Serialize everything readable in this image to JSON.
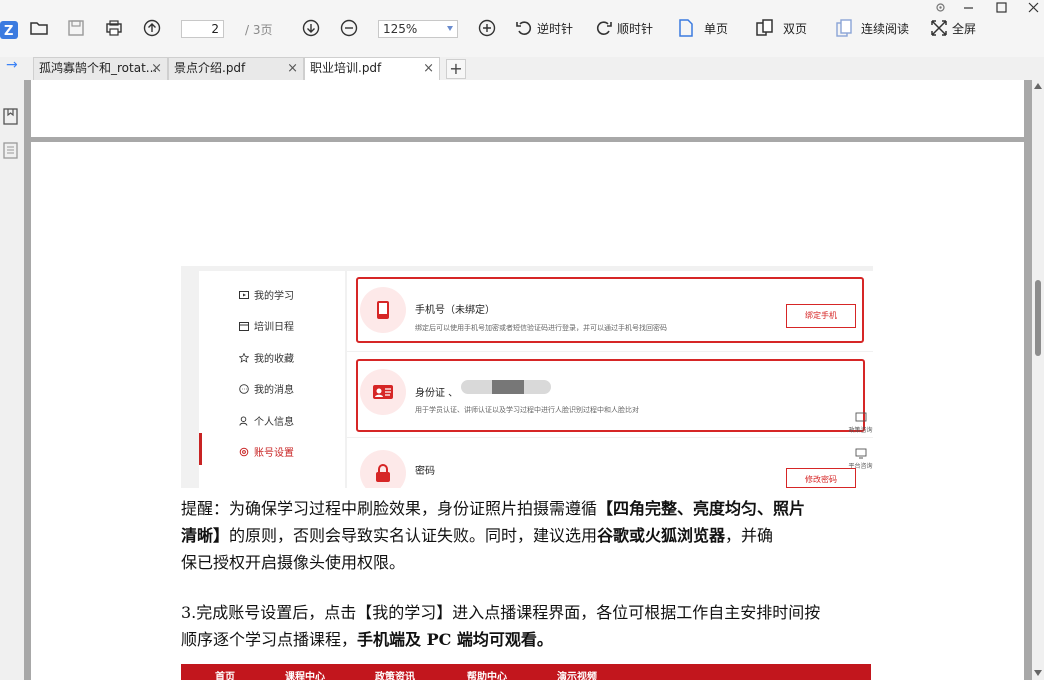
{
  "toolbar": {
    "page_current": "2",
    "page_total": "/ 3页",
    "zoom": "125%",
    "rotate_ccw": "逆时针",
    "rotate_cw": "顺时针",
    "single_page": "单页",
    "double_page": "双页",
    "continuous": "连续阅读",
    "fullscreen": "全屏"
  },
  "tabs": [
    {
      "label": "孤鸿寡鹄个和_rotat..."
    },
    {
      "label": "景点介绍.pdf"
    },
    {
      "label": "职业培训.pdf"
    }
  ],
  "embedded": {
    "menu": [
      "我的学习",
      "培训日程",
      "我的收藏",
      "我的消息",
      "个人信息",
      "账号设置"
    ],
    "phone_title": "手机号（未绑定）",
    "phone_desc": "绑定后可以使用手机号加密或者短信验证码进行登录，并可以通过手机号找回密码",
    "phone_btn": "绑定手机",
    "id_title": "身份证 、",
    "id_desc": "用于学员认证、讲师认证以及学习过程中进行人脸识别过程中和人脸比对",
    "pwd_title": "密码",
    "pwd_btn": "修改密码",
    "side1": "政策咨询",
    "side2": "平台咨询"
  },
  "para1": {
    "a": "提醒：为确保学习过程中刷脸效果，身份证照片拍摄需遵循",
    "b": "【四角完整、亮度均匀、照片",
    "c": "清晰】",
    "d": "的原则，否则会导致实名认证失败。同时，建议选用",
    "e": "谷歌或火狐浏览器",
    "f": "，并确",
    "g": "保已授权开启摄像头使用权限。"
  },
  "para2": {
    "a": "3.完成账号设置后，点击【我的学习】进入点播课程界面，各位可根据工作自主安排时间按",
    "b": "顺序逐个学习点播课程，",
    "c": "手机端及 PC 端均可观看。"
  },
  "nav": [
    "首页",
    "课程中心",
    "政策资讯",
    "帮助中心",
    "演示视频"
  ]
}
